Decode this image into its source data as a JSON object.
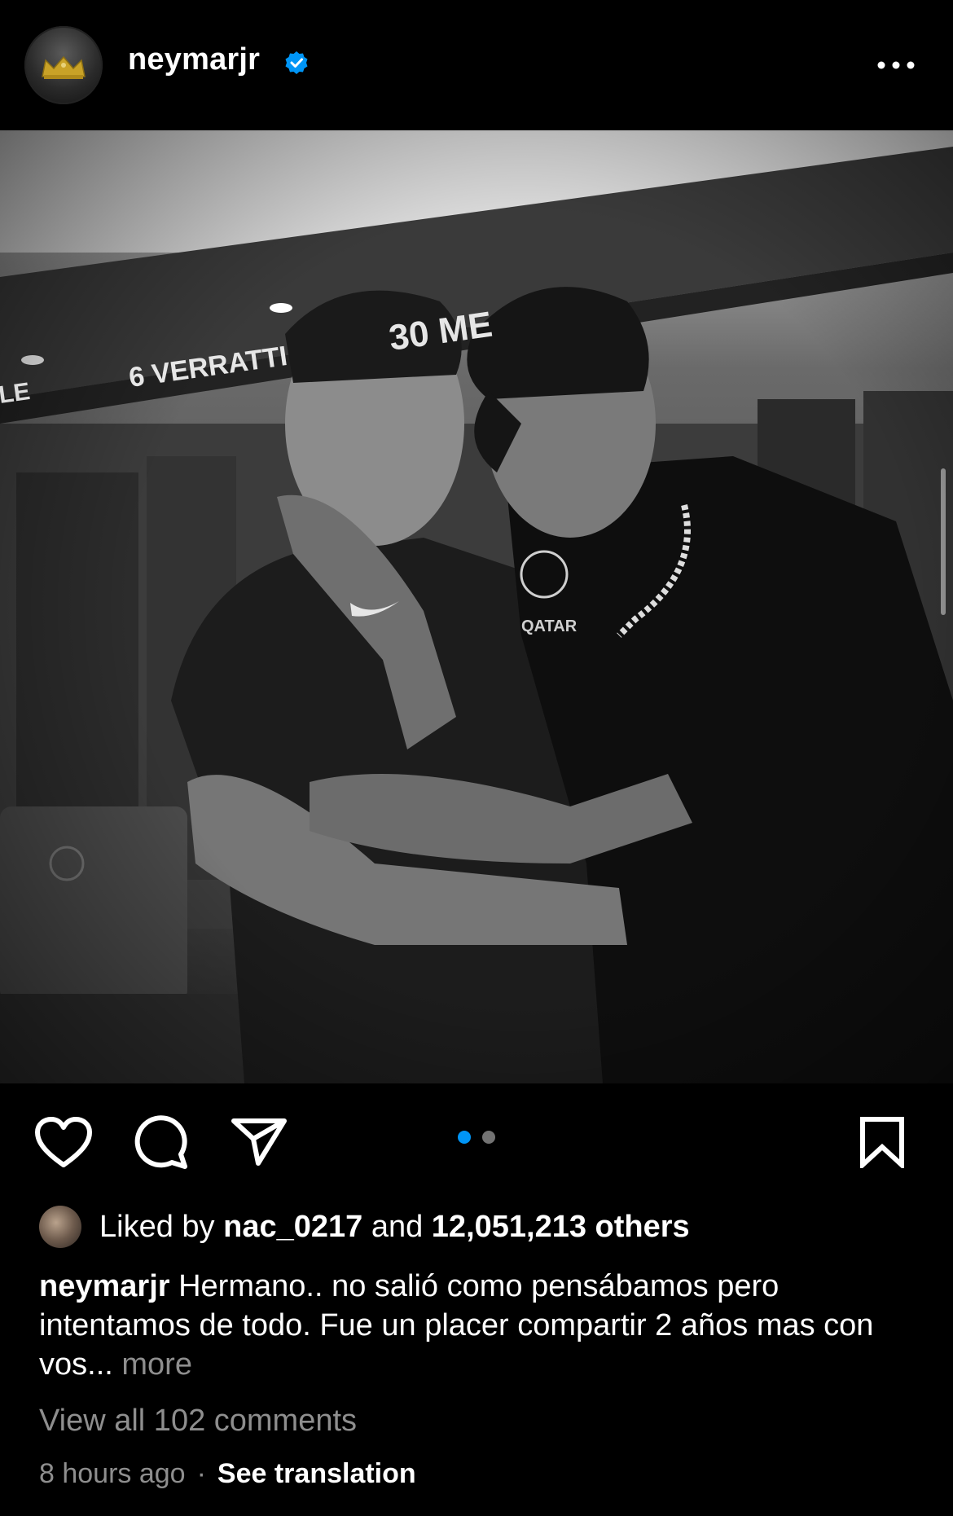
{
  "post": {
    "username": "neymarjr",
    "verified_icon": "verified-badge-icon",
    "avatar_icon": "crown-icon",
    "more_icon": "more-dots-icon"
  },
  "actions": {
    "like_icon": "heart-icon",
    "comment_icon": "comment-bubble-icon",
    "share_icon": "paper-plane-icon",
    "save_icon": "bookmark-icon",
    "carousel": {
      "total": 2,
      "active": 1,
      "active_color": "#0095f6",
      "inactive_color": "#737373"
    }
  },
  "likes": {
    "prefix": "Liked by",
    "liker": "nac_0217",
    "conjunction": "and",
    "others": "12,051,213 others"
  },
  "caption": {
    "author": "neymarjr",
    "text": "Hermano.. no salió como pensábamos pero intentamos de todo. Fue un placer compartir 2 años mas con vos...",
    "more": "more"
  },
  "comments": {
    "view_all": "View all 102 comments"
  },
  "meta": {
    "time": "8 hours ago",
    "separator": "·",
    "see_translation": "See translation"
  },
  "photo_signs": {
    "nameplate_left": "LE",
    "nameplate_middle": "6 VERRATTI",
    "nameplate_right": "30 ME",
    "shirt_text": "QATAR"
  },
  "colors": {
    "verified_blue": "#0095f6",
    "muted_text": "#8e8e8e",
    "background": "#000000"
  }
}
